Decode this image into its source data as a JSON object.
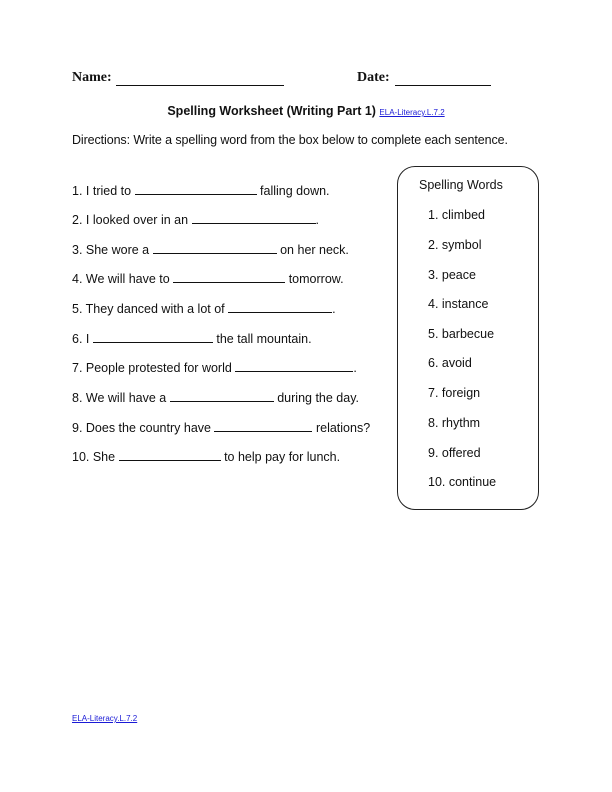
{
  "header": {
    "name_label": "Name:",
    "date_label": "Date:"
  },
  "title": {
    "text": "Spelling Worksheet (Writing Part 1)",
    "standard_link": "ELA-Literacy.L.7.2"
  },
  "directions": "Directions: Write a spelling word from the box below to complete each sentence.",
  "sentences": [
    {
      "before": "1. I tried to",
      "after": "falling down."
    },
    {
      "before": "2. I looked over in an",
      "after": "."
    },
    {
      "before": "3. She wore a",
      "after": "on her neck."
    },
    {
      "before": "4. We will have to",
      "after": "tomorrow."
    },
    {
      "before": "5. They danced with a lot of",
      "after": "."
    },
    {
      "before": "6. I",
      "after": "the tall mountain."
    },
    {
      "before": "7. People protested for world",
      "after": "."
    },
    {
      "before": "8. We will have a",
      "after": "during the day."
    },
    {
      "before": "9. Does the country have",
      "after": "relations?"
    },
    {
      "before": "10. She",
      "after": "to help pay for lunch."
    }
  ],
  "word_box": {
    "title": "Spelling Words",
    "words": [
      "1. climbed",
      "2. symbol",
      "3. peace",
      "4. instance",
      "5. barbecue",
      "6. avoid",
      "7. foreign",
      "8. rhythm",
      "9. offered",
      "10. continue"
    ]
  },
  "footer": {
    "standard_link": "ELA-Literacy.L.7.2"
  }
}
